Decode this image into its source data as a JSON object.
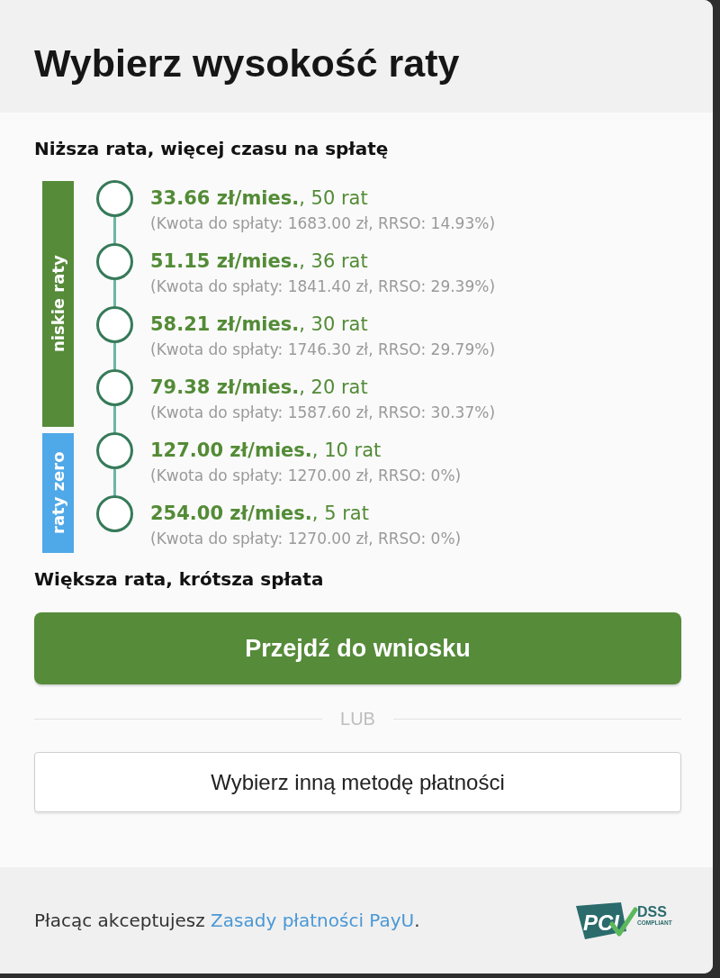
{
  "header": {
    "title": "Wybierz wysokość raty"
  },
  "plan": {
    "top_caption": "Niższa rata, więcej czasu na spłatę",
    "groups": [
      {
        "label": "niskie raty",
        "color": "#568b3a",
        "options": [
          {
            "rate": "**33.66 zł/mies.**, 50 rat",
            "details": "(Kwota do spłaty: 1683.00 zł, RRSO: 14.93%)",
            "selected": false
          },
          {
            "rate": "**51.15 zł/mies.**, 36 rat",
            "details": "(Kwota do spłaty: 1841.40 zł, RRSO: 29.39%)",
            "selected": false
          },
          {
            "rate": "**58.21 zł/mies.**, 30 rat",
            "details": "(Kwota do spłaty: 1746.30 zł, RRSO: 29.79%)",
            "selected": false
          },
          {
            "rate": "**79.38 zł/mies.**, 20 rat",
            "details": "(Kwota do spłaty: 1587.60 zł, RRSO: 30.37%)",
            "selected": false
          }
        ]
      },
      {
        "label": "raty zero",
        "color": "#4fa8e8",
        "options": [
          {
            "rate": "**127.00 zł/mies.**, 10 rat",
            "details": "(Kwota do spłaty: 1270.00 zł, RRSO: 0%)",
            "selected": false
          },
          {
            "rate": "**254.00 zł/mies.**, 5 rat",
            "details": "(Kwota do spłaty: 1270.00 zł, RRSO: 0%)",
            "selected": false
          }
        ]
      }
    ],
    "bottom_caption": "Większa rata, krótsza spłata"
  },
  "actions": {
    "primary": "Przejdź do wniosku",
    "separator": "LUB",
    "secondary": "Wybierz inną metodę płatności"
  },
  "footer": {
    "text": "Płacąc akceptujesz",
    "link": "Zasady płatności PayU",
    "after": ".",
    "logo": {
      "mark": "PCI",
      "title": "DSS",
      "subtitle": "COMPLIANT"
    }
  }
}
